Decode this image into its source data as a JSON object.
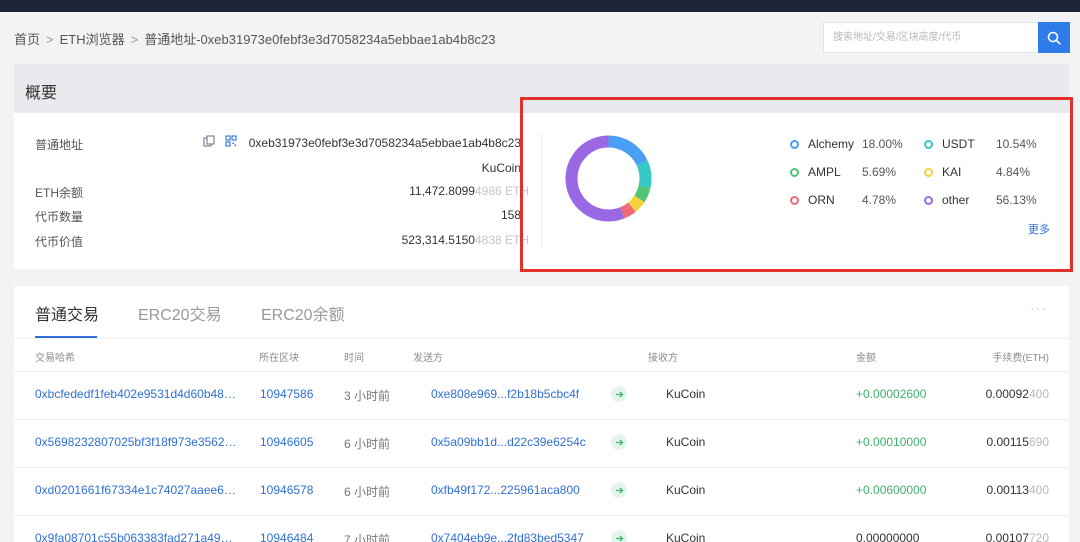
{
  "breadcrumb": {
    "home": "首页",
    "explorer": "ETH浏览器",
    "current": "普通地址-0xeb31973e0febf3e3d7058234a5ebbae1ab4b8c23"
  },
  "search": {
    "placeholder": "搜索地址/交易/区块高度/代币",
    "icon": "search-icon"
  },
  "overview": {
    "title": "概要",
    "address_label": "普通地址",
    "address": "0xeb31973e0febf3e3d7058234a5ebbae1ab4b8c23",
    "tag": "KuCoin",
    "eth_balance_label": "ETH余额",
    "eth_balance_main": "11,472.8099",
    "eth_balance_rest": "4986 ETH",
    "token_count_label": "代币数量",
    "token_count": "158",
    "token_value_label": "代币价值",
    "token_value_main": "523,314.5150",
    "token_value_rest": "4838 ETH",
    "more_label": "更多"
  },
  "chart_data": {
    "type": "pie",
    "categories": [
      "Alchemy",
      "USDT",
      "AMPL",
      "KAI",
      "ORN",
      "other"
    ],
    "values": [
      18.0,
      10.54,
      5.69,
      4.84,
      4.78,
      56.13
    ],
    "labels": [
      "18.00%",
      "10.54%",
      "5.69%",
      "4.84%",
      "4.78%",
      "56.13%"
    ],
    "colors": [
      "#4a9ff5",
      "#36c7c7",
      "#52c476",
      "#f3d23c",
      "#ee6a77",
      "#9b68e4"
    ]
  },
  "tabs": [
    "普通交易",
    "ERC20交易",
    "ERC20余额"
  ],
  "tab_more": "···",
  "table": {
    "headers": [
      "交易哈希",
      "所在区块",
      "时间",
      "发送方",
      "接收方",
      "金额",
      "手续费(ETH)"
    ],
    "rows": [
      {
        "hash": "0xbcfededf1feb402e9531d4d60b48…",
        "block": "10947586",
        "time": "3 小时前",
        "from": "0xe808e969...f2b18b5cbc4f",
        "to": "KuCoin",
        "amount": "+0.00002600",
        "fee_main": "0.00092",
        "fee_rest": "400"
      },
      {
        "hash": "0x5698232807025bf3f18f973e3562…",
        "block": "10946605",
        "time": "6 小时前",
        "from": "0x5a09bb1d...d22c39e6254c",
        "to": "KuCoin",
        "amount": "+0.00010000",
        "fee_main": "0.00115",
        "fee_rest": "690"
      },
      {
        "hash": "0xd0201661f67334e1c74027aaee6…",
        "block": "10946578",
        "time": "6 小时前",
        "from": "0xfb49f172...225961aca800",
        "to": "KuCoin",
        "amount": "+0.00600000",
        "fee_main": "0.00113",
        "fee_rest": "400"
      },
      {
        "hash": "0x9fa08701c55b063383fad271a49…",
        "block": "10946484",
        "time": "7 小时前",
        "from": "0x7404eb9e...2fd83bed5347",
        "to": "KuCoin",
        "amount": "0.00000000",
        "fee_main": "0.00107",
        "fee_rest": "720"
      }
    ]
  }
}
